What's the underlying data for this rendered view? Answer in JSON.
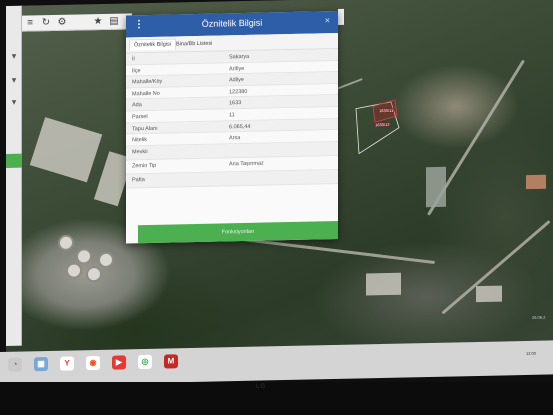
{
  "dialog": {
    "title": "Öznitelik Bilgisi",
    "menu_icon": "⋮",
    "close_icon": "×",
    "tabs": [
      {
        "label": "Öznitelik Bilgisi"
      },
      {
        "label": "Bina/Bb Listesi"
      }
    ],
    "rows": [
      {
        "label": "İl",
        "value": "Sakarya"
      },
      {
        "label": "İlçe",
        "value": "Arifiye"
      },
      {
        "label": "Mahalle/Köy",
        "value": "Adliye"
      },
      {
        "label": "Mahalle No",
        "value": "122380"
      },
      {
        "label": "Ada",
        "value": "1633"
      },
      {
        "label": "Parsel",
        "value": "11"
      },
      {
        "label": "Tapu Alanı",
        "value": "6.065,44"
      },
      {
        "label": "Nitelik",
        "value": "Arsa"
      },
      {
        "label": "Mevkii",
        "value": ""
      },
      {
        "label": "Zemin Tip",
        "value": "Ana Taşınmaz"
      },
      {
        "label": "Pafta",
        "value": ""
      }
    ],
    "button_label": "Fonksiyonları"
  },
  "map": {
    "labels": [
      "1633/11",
      "1633/12"
    ],
    "scale_text": "26.06.2"
  },
  "toolbar": {
    "icons": [
      "menu-icon",
      "refresh-icon",
      "settings-icon",
      "star-icon",
      "trash-icon",
      "flag-icon"
    ]
  },
  "taskbar": {
    "clock": "12:00"
  },
  "bezel": {
    "brand": "LG"
  },
  "colors": {
    "dialog_header": "#2f5ea8",
    "action_button": "#4caf50"
  }
}
